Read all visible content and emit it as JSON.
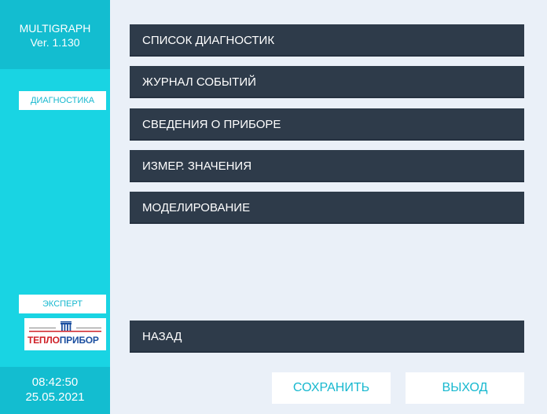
{
  "sidebar": {
    "app_name": "MULTIGRAPH",
    "version": "Ver. 1.130",
    "mode_diagnostics": "ДИАГНОСТИКА",
    "mode_expert": "ЭКСПЕРТ",
    "logo": {
      "small_left": "ГРУППА ПРЕДПРИЯТИЙ",
      "small_right": "ЧЕЛЯБИНСК",
      "word_part1": "ТЕПЛО",
      "word_part2": "ПРИБОР"
    },
    "time": "08:42:50",
    "date": "25.05.2021"
  },
  "menu": {
    "items": [
      {
        "label": "СПИСОК ДИАГНОСТИК"
      },
      {
        "label": "ЖУРНАЛ СОБЫТИЙ"
      },
      {
        "label": "СВЕДЕНИЯ О ПРИБОРЕ"
      },
      {
        "label": "ИЗМЕР. ЗНАЧЕНИЯ"
      },
      {
        "label": "МОДЕЛИРОВАНИЕ"
      }
    ],
    "back_label": "НАЗАД"
  },
  "actions": {
    "save_label": "СОХРАНИТЬ",
    "exit_label": "ВЫХОД"
  },
  "colors": {
    "sidebar": "#19d4e3",
    "sidebar_dark": "#13bdd0",
    "button_dark": "#2e3b4a",
    "background": "#eaf0f8",
    "accent_text": "#17b8cf"
  }
}
